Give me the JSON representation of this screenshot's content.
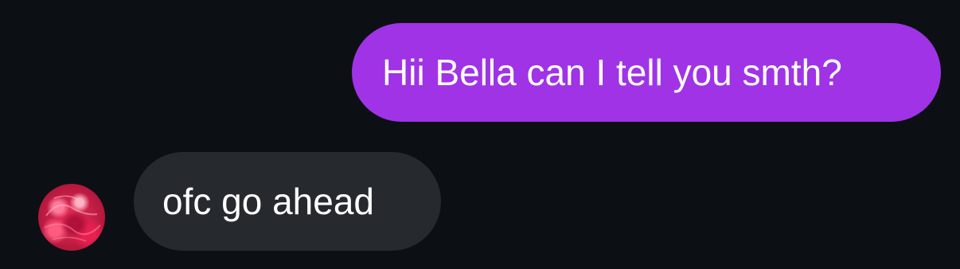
{
  "conversation": {
    "messages": [
      {
        "sender": "me",
        "text": "Hii Bella can I tell you smth?"
      },
      {
        "sender": "contact",
        "text": "ofc go ahead"
      }
    ],
    "contact": {
      "avatar_icon": "profile-photo"
    }
  },
  "colors": {
    "background": "#0c1014",
    "sent_bubble": "#a033e6",
    "received_bubble": "#262a2f",
    "text": "#ffffff",
    "avatar_primary": "#e8305a"
  }
}
